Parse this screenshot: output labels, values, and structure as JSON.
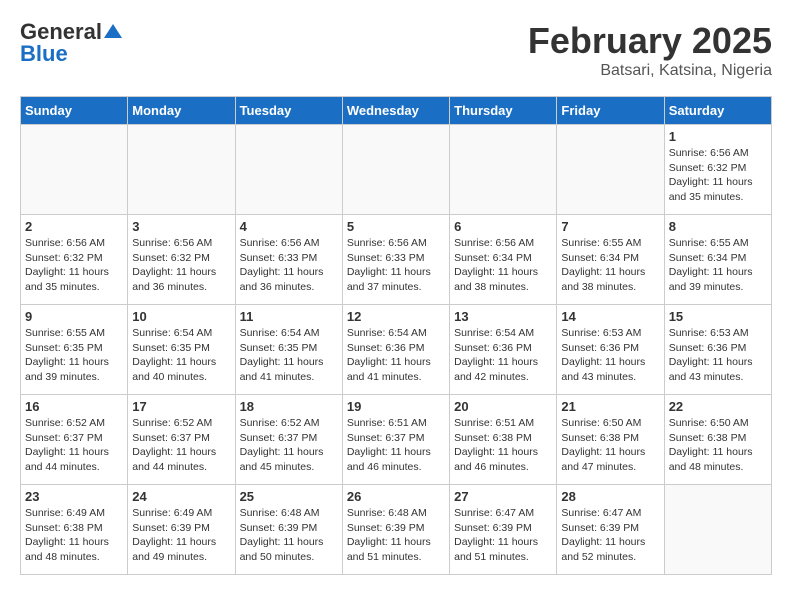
{
  "header": {
    "logo_general": "General",
    "logo_blue": "Blue",
    "title": "February 2025",
    "subtitle": "Batsari, Katsina, Nigeria"
  },
  "calendar": {
    "days_of_week": [
      "Sunday",
      "Monday",
      "Tuesday",
      "Wednesday",
      "Thursday",
      "Friday",
      "Saturday"
    ],
    "weeks": [
      [
        {
          "day": "",
          "info": ""
        },
        {
          "day": "",
          "info": ""
        },
        {
          "day": "",
          "info": ""
        },
        {
          "day": "",
          "info": ""
        },
        {
          "day": "",
          "info": ""
        },
        {
          "day": "",
          "info": ""
        },
        {
          "day": "1",
          "info": "Sunrise: 6:56 AM\nSunset: 6:32 PM\nDaylight: 11 hours and 35 minutes."
        }
      ],
      [
        {
          "day": "2",
          "info": "Sunrise: 6:56 AM\nSunset: 6:32 PM\nDaylight: 11 hours and 35 minutes."
        },
        {
          "day": "3",
          "info": "Sunrise: 6:56 AM\nSunset: 6:32 PM\nDaylight: 11 hours and 36 minutes."
        },
        {
          "day": "4",
          "info": "Sunrise: 6:56 AM\nSunset: 6:33 PM\nDaylight: 11 hours and 36 minutes."
        },
        {
          "day": "5",
          "info": "Sunrise: 6:56 AM\nSunset: 6:33 PM\nDaylight: 11 hours and 37 minutes."
        },
        {
          "day": "6",
          "info": "Sunrise: 6:56 AM\nSunset: 6:34 PM\nDaylight: 11 hours and 38 minutes."
        },
        {
          "day": "7",
          "info": "Sunrise: 6:55 AM\nSunset: 6:34 PM\nDaylight: 11 hours and 38 minutes."
        },
        {
          "day": "8",
          "info": "Sunrise: 6:55 AM\nSunset: 6:34 PM\nDaylight: 11 hours and 39 minutes."
        }
      ],
      [
        {
          "day": "9",
          "info": "Sunrise: 6:55 AM\nSunset: 6:35 PM\nDaylight: 11 hours and 39 minutes."
        },
        {
          "day": "10",
          "info": "Sunrise: 6:54 AM\nSunset: 6:35 PM\nDaylight: 11 hours and 40 minutes."
        },
        {
          "day": "11",
          "info": "Sunrise: 6:54 AM\nSunset: 6:35 PM\nDaylight: 11 hours and 41 minutes."
        },
        {
          "day": "12",
          "info": "Sunrise: 6:54 AM\nSunset: 6:36 PM\nDaylight: 11 hours and 41 minutes."
        },
        {
          "day": "13",
          "info": "Sunrise: 6:54 AM\nSunset: 6:36 PM\nDaylight: 11 hours and 42 minutes."
        },
        {
          "day": "14",
          "info": "Sunrise: 6:53 AM\nSunset: 6:36 PM\nDaylight: 11 hours and 43 minutes."
        },
        {
          "day": "15",
          "info": "Sunrise: 6:53 AM\nSunset: 6:36 PM\nDaylight: 11 hours and 43 minutes."
        }
      ],
      [
        {
          "day": "16",
          "info": "Sunrise: 6:52 AM\nSunset: 6:37 PM\nDaylight: 11 hours and 44 minutes."
        },
        {
          "day": "17",
          "info": "Sunrise: 6:52 AM\nSunset: 6:37 PM\nDaylight: 11 hours and 44 minutes."
        },
        {
          "day": "18",
          "info": "Sunrise: 6:52 AM\nSunset: 6:37 PM\nDaylight: 11 hours and 45 minutes."
        },
        {
          "day": "19",
          "info": "Sunrise: 6:51 AM\nSunset: 6:37 PM\nDaylight: 11 hours and 46 minutes."
        },
        {
          "day": "20",
          "info": "Sunrise: 6:51 AM\nSunset: 6:38 PM\nDaylight: 11 hours and 46 minutes."
        },
        {
          "day": "21",
          "info": "Sunrise: 6:50 AM\nSunset: 6:38 PM\nDaylight: 11 hours and 47 minutes."
        },
        {
          "day": "22",
          "info": "Sunrise: 6:50 AM\nSunset: 6:38 PM\nDaylight: 11 hours and 48 minutes."
        }
      ],
      [
        {
          "day": "23",
          "info": "Sunrise: 6:49 AM\nSunset: 6:38 PM\nDaylight: 11 hours and 48 minutes."
        },
        {
          "day": "24",
          "info": "Sunrise: 6:49 AM\nSunset: 6:39 PM\nDaylight: 11 hours and 49 minutes."
        },
        {
          "day": "25",
          "info": "Sunrise: 6:48 AM\nSunset: 6:39 PM\nDaylight: 11 hours and 50 minutes."
        },
        {
          "day": "26",
          "info": "Sunrise: 6:48 AM\nSunset: 6:39 PM\nDaylight: 11 hours and 51 minutes."
        },
        {
          "day": "27",
          "info": "Sunrise: 6:47 AM\nSunset: 6:39 PM\nDaylight: 11 hours and 51 minutes."
        },
        {
          "day": "28",
          "info": "Sunrise: 6:47 AM\nSunset: 6:39 PM\nDaylight: 11 hours and 52 minutes."
        },
        {
          "day": "",
          "info": ""
        }
      ]
    ]
  }
}
